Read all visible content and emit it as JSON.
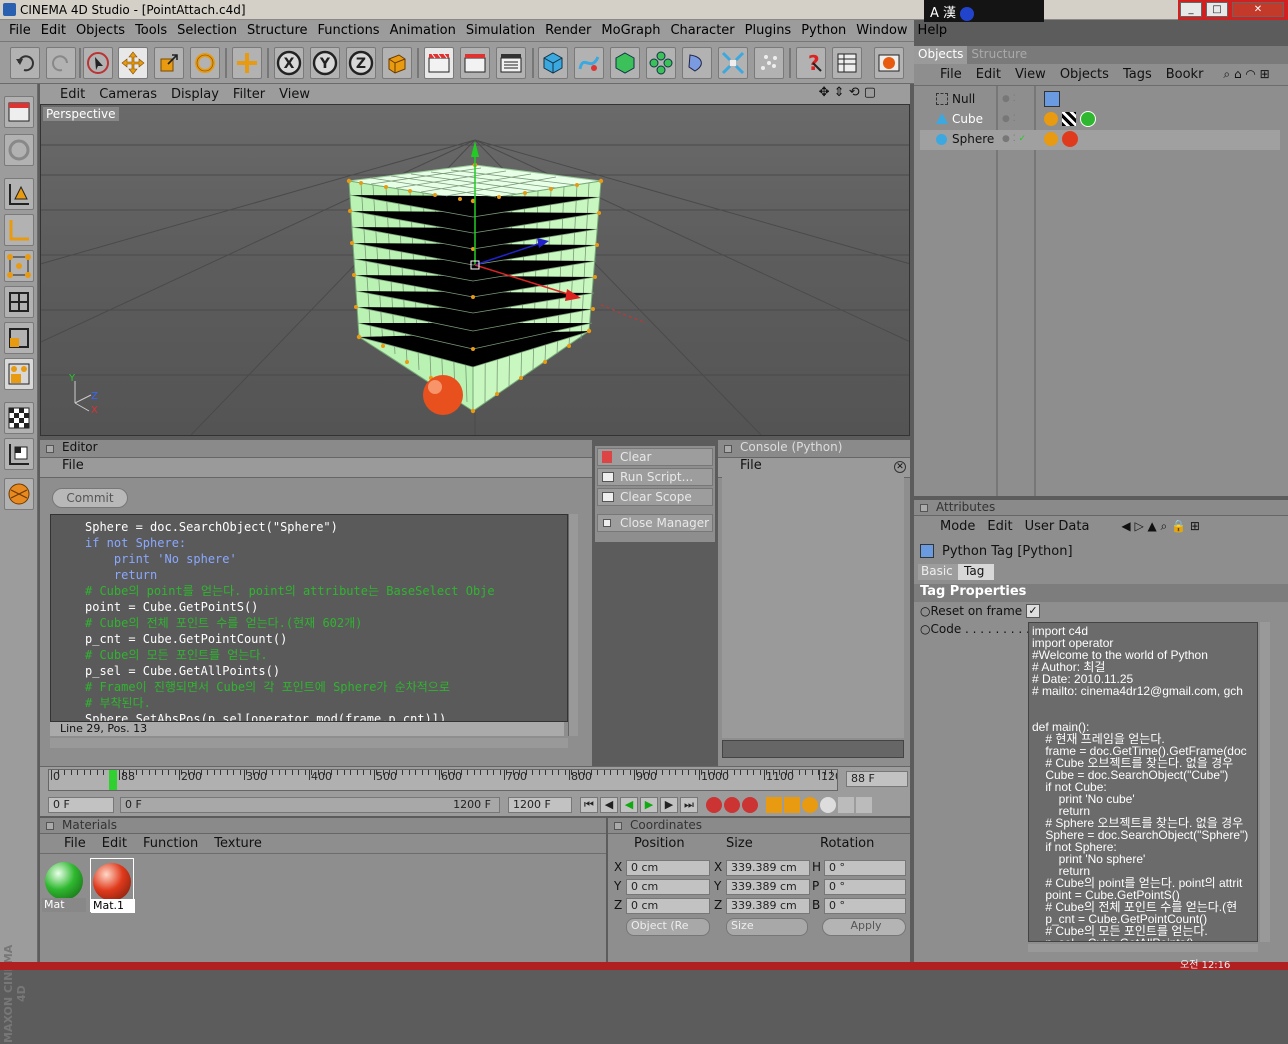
{
  "window": {
    "app_title": "CINEMA 4D Studio - [PointAttach.c4d]",
    "ime_label": "A 漢"
  },
  "menubar": [
    "File",
    "Edit",
    "Objects",
    "Tools",
    "Selection",
    "Structure",
    "Functions",
    "Animation",
    "Simulation",
    "Render",
    "MoGraph",
    "Character",
    "Plugins",
    "Python",
    "Window",
    "Help"
  ],
  "toolbar_icons": [
    "undo-icon",
    "redo-icon",
    "live-select-icon",
    "move-icon",
    "scale-icon",
    "rotate-icon",
    "add-tool-icon",
    "x-axis-icon",
    "y-axis-icon",
    "z-axis-icon",
    "coordinate-system-icon",
    "render-view-icon",
    "render-picture-icon",
    "render-settings-icon",
    "cube-icon",
    "spline-icon",
    "nurbs-icon",
    "array-icon",
    "deformer-icon",
    "scene-icon",
    "particle-icon",
    "help-icon",
    "render-queue-icon",
    "web-icon"
  ],
  "toolbar_axes": {
    "x": "X",
    "y": "Y",
    "z": "Z"
  },
  "left_toolbar_icons": [
    "layout-icon",
    "model-tool-icon",
    "object-mode-icon",
    "axis-mode-icon",
    "points-mode-icon",
    "edges-mode-icon",
    "polygons-mode-icon",
    "uv-mode-icon",
    "texture-mode-icon",
    "workplane-mode-icon",
    "sculpt-icon"
  ],
  "brand": {
    "line1": "MAXON",
    "line2": "CINEMA 4D"
  },
  "viewport": {
    "menu": [
      "Edit",
      "Cameras",
      "Display",
      "Filter",
      "View"
    ],
    "label": "Perspective",
    "axis_x": "X",
    "axis_y": "Y",
    "axis_z": "Z"
  },
  "editor": {
    "title": "Editor",
    "menu_file": "File",
    "commit_label": "Commit",
    "status": "Line 29, Pos. 13",
    "code_lines": [
      {
        "text": "Sphere = doc.SearchObject(\"Sphere\")",
        "cls": "str"
      },
      {
        "text": "if not Sphere:",
        "cls": "kw"
      },
      {
        "text": "    print 'No sphere'",
        "cls": "kw"
      },
      {
        "text": "    return",
        "cls": "kw"
      },
      {
        "text": "# Cube의 point를 얻는다. point의 attribute는 BaseSelect Obje",
        "cls": "cm"
      },
      {
        "text": "point = Cube.GetPointS()",
        "cls": "str"
      },
      {
        "text": "# Cube의 전체 포인트 수를 얻는다.(현재 602개)",
        "cls": "cm"
      },
      {
        "text": "p_cnt = Cube.GetPointCount()",
        "cls": "str"
      },
      {
        "text": "# Cube의 모든 포인트를 얻는다.",
        "cls": "cm"
      },
      {
        "text": "p_sel = Cube.GetAllPoints()",
        "cls": "str"
      },
      {
        "text": "# Frame이 진행되면서 Cube의 각 포인트에 Sphere가 순차적으로",
        "cls": "cm"
      },
      {
        "text": "# 부착된다.",
        "cls": "cm"
      },
      {
        "text": "Sphere.SetAbsPos(p_sel[operator.mod(frame,p_cnt)])",
        "cls": "str"
      }
    ]
  },
  "script_manager": {
    "clear": "Clear",
    "run": "Run Script...",
    "clear_scope": "Clear Scope",
    "close": "Close Manager"
  },
  "console": {
    "title": "Console (Python)",
    "menu_file": "File"
  },
  "timeline": {
    "ticks": [
      "0",
      "88",
      "200",
      "300",
      "400",
      "500",
      "600",
      "700",
      "800",
      "900",
      "1000",
      "1100",
      "120"
    ],
    "current_frame": "88 F",
    "start": "0 F",
    "range_start": "0 F",
    "range_end": "1200 F",
    "end": "1200 F"
  },
  "materials": {
    "title": "Materials",
    "menu": [
      "File",
      "Edit",
      "Function",
      "Texture"
    ],
    "items": [
      {
        "name": "Mat",
        "color": "#2fb82f"
      },
      {
        "name": "Mat.1",
        "color": "#e03a1c"
      }
    ]
  },
  "coordinates": {
    "title": "Coordinates",
    "headers": [
      "Position",
      "Size",
      "Rotation"
    ],
    "rows": [
      {
        "axis": "X",
        "pos": "0 cm",
        "size": "339.389 cm",
        "rot_axis": "H",
        "rot": "0 °"
      },
      {
        "axis": "Y",
        "pos": "0 cm",
        "size": "339.389 cm",
        "rot_axis": "P",
        "rot": "0 °"
      },
      {
        "axis": "Z",
        "pos": "0 cm",
        "size": "339.389 cm",
        "rot_axis": "B",
        "rot": "0 °"
      }
    ],
    "mode": "Object (Re",
    "size_mode": "Size",
    "apply": "Apply"
  },
  "objects_panel": {
    "tabs": [
      "Objects",
      "Structure"
    ],
    "menu": [
      "File",
      "Edit",
      "View",
      "Objects",
      "Tags",
      "Bookr"
    ],
    "items": [
      {
        "name": "Null",
        "icon": "null-object-icon"
      },
      {
        "name": "Cube",
        "icon": "cube-object-icon"
      },
      {
        "name": "Sphere",
        "icon": "sphere-object-icon"
      }
    ]
  },
  "attributes": {
    "title": "Attributes",
    "menu": [
      "Mode",
      "Edit",
      "User Data"
    ],
    "object_title": "Python Tag [Python]",
    "tabs": [
      "Basic",
      "Tag"
    ],
    "section": "Tag Properties",
    "reset_label": "Reset on frame 0",
    "code_label": "Code . . . . . . . . . .",
    "code_lines": [
      "import c4d",
      "import operator",
      "#Welcome to the world of Python",
      "# Author: 최걸",
      "# Date: 2010.11.25",
      "# mailto: cinema4dr12@gmail.com, gch",
      "",
      "",
      "def main():",
      "    # 현재 프레임을 얻는다.",
      "    frame = doc.GetTime().GetFrame(doc",
      "    # Cube 오브젝트를 찾는다. 없을 경우",
      "    Cube = doc.SearchObject(\"Cube\")",
      "    if not Cube:",
      "        print 'No cube'",
      "        return",
      "    # Sphere 오브젝트를 찾는다. 없을 경우",
      "    Sphere = doc.SearchObject(\"Sphere\")",
      "    if not Sphere:",
      "        print 'No sphere'",
      "        return",
      "    # Cube의 point를 얻는다. point의 attrit",
      "    point = Cube.GetPointS()",
      "    # Cube의 전체 포인트 수를 얻는다.(현",
      "    p_cnt = Cube.GetPointCount()",
      "    # Cube의 모든 포인트를 얻는다.",
      "    p_sel = Cube.GetAllPoints()"
    ]
  },
  "clock": "오전 12:16"
}
